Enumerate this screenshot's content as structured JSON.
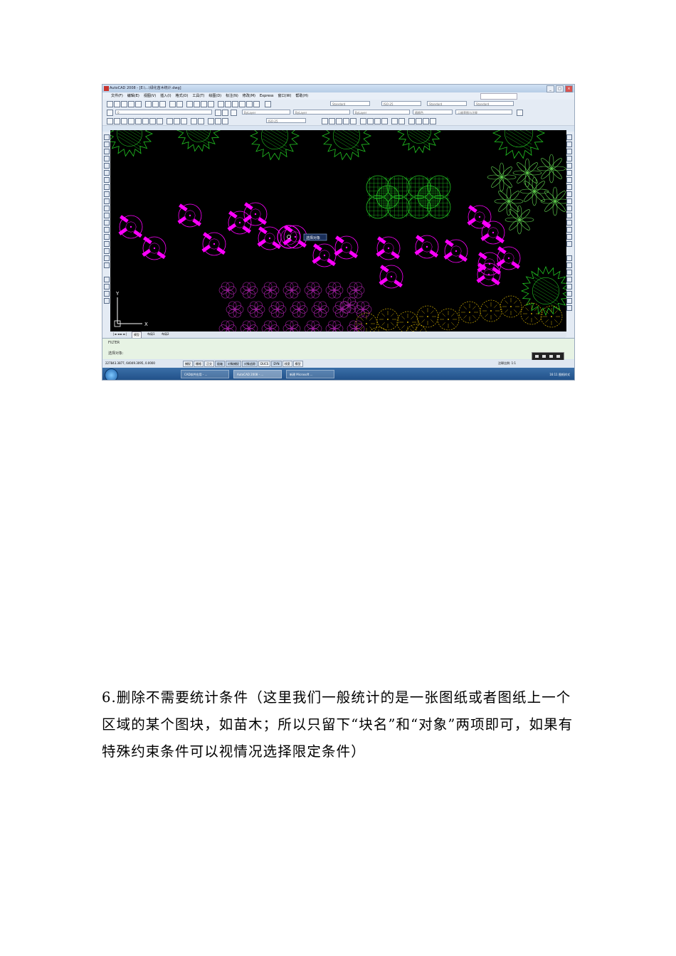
{
  "screenshot": {
    "window_title": "AutoCAD 2008 - [E:\\...\\绿化苗木统计.dwg]",
    "menu_items": [
      "文件(F)",
      "编辑(E)",
      "视图(V)",
      "插入(I)",
      "格式(O)",
      "工具(T)",
      "绘图(D)",
      "标注(N)",
      "修改(M)",
      "Express",
      "窗口(W)",
      "帮助(H)"
    ],
    "style_combo_1": "Standard",
    "style_combo_2": "ISO-25",
    "style_combo_3": "Standard",
    "style_combo_4": "Standard",
    "layer_combo": "0",
    "color_combo": "ByLayer",
    "linetype_combo": "ByLayer",
    "lineweight_combo": "ByLayer",
    "plot_style_combo": "随颜色",
    "workspace_combo": "二维草图与注释",
    "tooltip": "选择对象",
    "layout_tabs": [
      "模型",
      "布局1",
      "布局2"
    ],
    "cmd_history": "FILTER",
    "cmd_prompt": "选择对象:",
    "coords": "227843.3877, 64049.3095, 0.0000",
    "status_toggles": [
      "捕捉",
      "栅格",
      "正交",
      "极轴",
      "对象捕捉",
      "对象追踪",
      "DUCS",
      "DYN",
      "线宽",
      "模型"
    ],
    "scale_label": "注释比例: 1:1",
    "taskbar_items": [
      "CAD软件应用 - ...",
      "AutoCAD 2008 - ...",
      "新建 Microsoft ..."
    ],
    "clock": "16:11 图纸样式"
  },
  "paragraph": "6.删除不需要统计条件（这里我们一般统计的是一张图纸或者图纸上一个区域的某个图块，如苗木；所以只留下“块名”和“对象”两项即可，如果有特殊约束条件可以视情况选择限定条件）",
  "colors": {
    "canvas_bg": "#000000",
    "selected_blocks": "#ff00ff",
    "green_trees": "#22c522",
    "light_green_trees": "#66dd55",
    "yellow_trees": "#c8a800",
    "purple_shrubs": "#a020a0"
  }
}
